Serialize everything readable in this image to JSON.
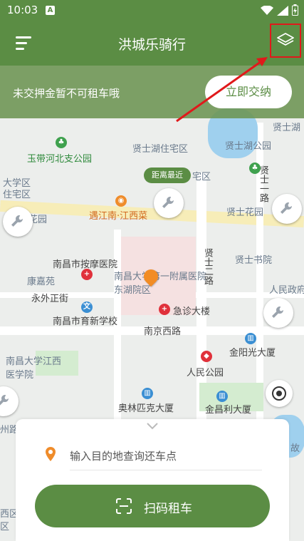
{
  "status_bar": {
    "time": "10:03",
    "notification_icon": "A"
  },
  "app_bar": {
    "title": "洪城乐骑行",
    "menu_icon": "menu-icon",
    "layers_icon": "layers-icon"
  },
  "deposit_notice": {
    "message": "未交押金暂不可租车哦",
    "button_label": "立即交纳"
  },
  "map": {
    "nearest_tag": "距离最近",
    "labels": [
      "玉带河北支公园",
      "大学区",
      "住宅区",
      "花园",
      "遇江南·江西菜",
      "贤士湖住宅区",
      "宅区",
      "贤士湖公园",
      "贤士一路",
      "贤士花园",
      "南昌市按摩医院",
      "康嘉苑",
      "永外正街",
      "南昌大学第一附属医院东湖院区",
      "贤士二路",
      "贤士书院",
      "人民政府",
      "南昌市育新学校",
      "急诊大楼",
      "南京西路",
      "南昌大学江西医学院",
      "人民公园",
      "金阳光大厦",
      "奥林匹克大厦",
      "金昌利大厦",
      "贤士湖",
      "故",
      "州路",
      "西区",
      "区"
    ]
  },
  "bottom_panel": {
    "destination_placeholder": "输入目的地查询还车点",
    "scan_button_label": "扫码租车"
  },
  "colors": {
    "brand_green": "#5b8d44",
    "annotation_red": "#e0191b"
  }
}
